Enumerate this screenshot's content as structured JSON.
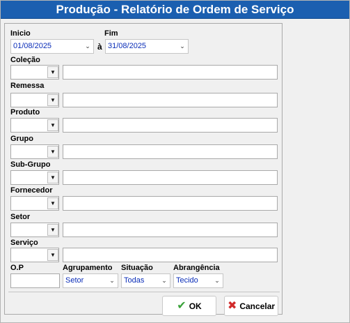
{
  "window": {
    "title": "Produção - Relatório de Ordem de Serviço"
  },
  "period": {
    "start_label": "Inicio",
    "start_value": "01/08/2025",
    "separator": "à",
    "end_label": "Fim",
    "end_value": "31/08/2025"
  },
  "filters": [
    {
      "label": "Coleção"
    },
    {
      "label": "Remessa"
    },
    {
      "label": "Produto"
    },
    {
      "label": "Grupo"
    },
    {
      "label": "Sub-Grupo"
    },
    {
      "label": "Fornecedor"
    },
    {
      "label": "Setor"
    },
    {
      "label": "Serviço"
    }
  ],
  "bottom": {
    "op_label": "O.P",
    "op_value": "",
    "agrupamento_label": "Agrupamento",
    "agrupamento_value": "Setor",
    "situacao_label": "Situação",
    "situacao_value": "Todas",
    "abrangencia_label": "Abrangência",
    "abrangencia_value": "Tecido"
  },
  "buttons": {
    "ok_label": "OK",
    "cancel_label": "Cancelar"
  },
  "colors": {
    "titlebar": "#1b5fb0",
    "value_text": "#0a2db8",
    "ok_icon": "#3aa23a",
    "cancel_icon": "#d12a2a"
  }
}
